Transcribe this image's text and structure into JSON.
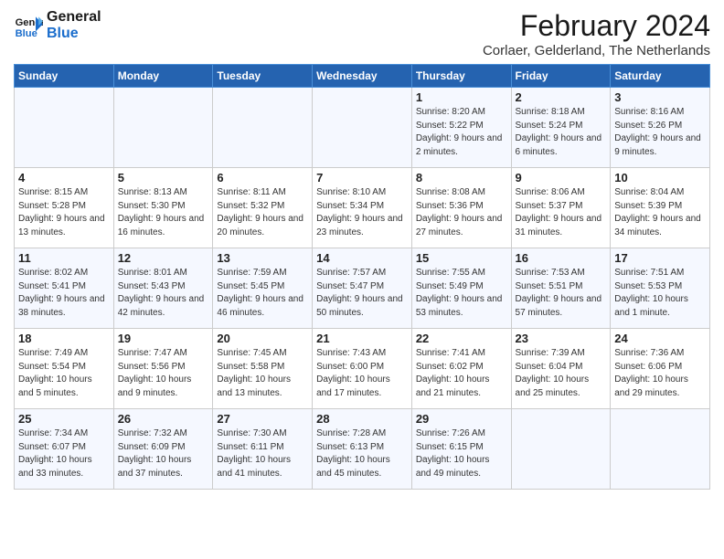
{
  "logo": {
    "line1": "General",
    "line2": "Blue"
  },
  "title": "February 2024",
  "subtitle": "Corlaer, Gelderland, The Netherlands",
  "headers": [
    "Sunday",
    "Monday",
    "Tuesday",
    "Wednesday",
    "Thursday",
    "Friday",
    "Saturday"
  ],
  "weeks": [
    [
      {
        "day": "",
        "info": ""
      },
      {
        "day": "",
        "info": ""
      },
      {
        "day": "",
        "info": ""
      },
      {
        "day": "",
        "info": ""
      },
      {
        "day": "1",
        "info": "Sunrise: 8:20 AM\nSunset: 5:22 PM\nDaylight: 9 hours\nand 2 minutes."
      },
      {
        "day": "2",
        "info": "Sunrise: 8:18 AM\nSunset: 5:24 PM\nDaylight: 9 hours\nand 6 minutes."
      },
      {
        "day": "3",
        "info": "Sunrise: 8:16 AM\nSunset: 5:26 PM\nDaylight: 9 hours\nand 9 minutes."
      }
    ],
    [
      {
        "day": "4",
        "info": "Sunrise: 8:15 AM\nSunset: 5:28 PM\nDaylight: 9 hours\nand 13 minutes."
      },
      {
        "day": "5",
        "info": "Sunrise: 8:13 AM\nSunset: 5:30 PM\nDaylight: 9 hours\nand 16 minutes."
      },
      {
        "day": "6",
        "info": "Sunrise: 8:11 AM\nSunset: 5:32 PM\nDaylight: 9 hours\nand 20 minutes."
      },
      {
        "day": "7",
        "info": "Sunrise: 8:10 AM\nSunset: 5:34 PM\nDaylight: 9 hours\nand 23 minutes."
      },
      {
        "day": "8",
        "info": "Sunrise: 8:08 AM\nSunset: 5:36 PM\nDaylight: 9 hours\nand 27 minutes."
      },
      {
        "day": "9",
        "info": "Sunrise: 8:06 AM\nSunset: 5:37 PM\nDaylight: 9 hours\nand 31 minutes."
      },
      {
        "day": "10",
        "info": "Sunrise: 8:04 AM\nSunset: 5:39 PM\nDaylight: 9 hours\nand 34 minutes."
      }
    ],
    [
      {
        "day": "11",
        "info": "Sunrise: 8:02 AM\nSunset: 5:41 PM\nDaylight: 9 hours\nand 38 minutes."
      },
      {
        "day": "12",
        "info": "Sunrise: 8:01 AM\nSunset: 5:43 PM\nDaylight: 9 hours\nand 42 minutes."
      },
      {
        "day": "13",
        "info": "Sunrise: 7:59 AM\nSunset: 5:45 PM\nDaylight: 9 hours\nand 46 minutes."
      },
      {
        "day": "14",
        "info": "Sunrise: 7:57 AM\nSunset: 5:47 PM\nDaylight: 9 hours\nand 50 minutes."
      },
      {
        "day": "15",
        "info": "Sunrise: 7:55 AM\nSunset: 5:49 PM\nDaylight: 9 hours\nand 53 minutes."
      },
      {
        "day": "16",
        "info": "Sunrise: 7:53 AM\nSunset: 5:51 PM\nDaylight: 9 hours\nand 57 minutes."
      },
      {
        "day": "17",
        "info": "Sunrise: 7:51 AM\nSunset: 5:53 PM\nDaylight: 10 hours\nand 1 minute."
      }
    ],
    [
      {
        "day": "18",
        "info": "Sunrise: 7:49 AM\nSunset: 5:54 PM\nDaylight: 10 hours\nand 5 minutes."
      },
      {
        "day": "19",
        "info": "Sunrise: 7:47 AM\nSunset: 5:56 PM\nDaylight: 10 hours\nand 9 minutes."
      },
      {
        "day": "20",
        "info": "Sunrise: 7:45 AM\nSunset: 5:58 PM\nDaylight: 10 hours\nand 13 minutes."
      },
      {
        "day": "21",
        "info": "Sunrise: 7:43 AM\nSunset: 6:00 PM\nDaylight: 10 hours\nand 17 minutes."
      },
      {
        "day": "22",
        "info": "Sunrise: 7:41 AM\nSunset: 6:02 PM\nDaylight: 10 hours\nand 21 minutes."
      },
      {
        "day": "23",
        "info": "Sunrise: 7:39 AM\nSunset: 6:04 PM\nDaylight: 10 hours\nand 25 minutes."
      },
      {
        "day": "24",
        "info": "Sunrise: 7:36 AM\nSunset: 6:06 PM\nDaylight: 10 hours\nand 29 minutes."
      }
    ],
    [
      {
        "day": "25",
        "info": "Sunrise: 7:34 AM\nSunset: 6:07 PM\nDaylight: 10 hours\nand 33 minutes."
      },
      {
        "day": "26",
        "info": "Sunrise: 7:32 AM\nSunset: 6:09 PM\nDaylight: 10 hours\nand 37 minutes."
      },
      {
        "day": "27",
        "info": "Sunrise: 7:30 AM\nSunset: 6:11 PM\nDaylight: 10 hours\nand 41 minutes."
      },
      {
        "day": "28",
        "info": "Sunrise: 7:28 AM\nSunset: 6:13 PM\nDaylight: 10 hours\nand 45 minutes."
      },
      {
        "day": "29",
        "info": "Sunrise: 7:26 AM\nSunset: 6:15 PM\nDaylight: 10 hours\nand 49 minutes."
      },
      {
        "day": "",
        "info": ""
      },
      {
        "day": "",
        "info": ""
      }
    ]
  ]
}
